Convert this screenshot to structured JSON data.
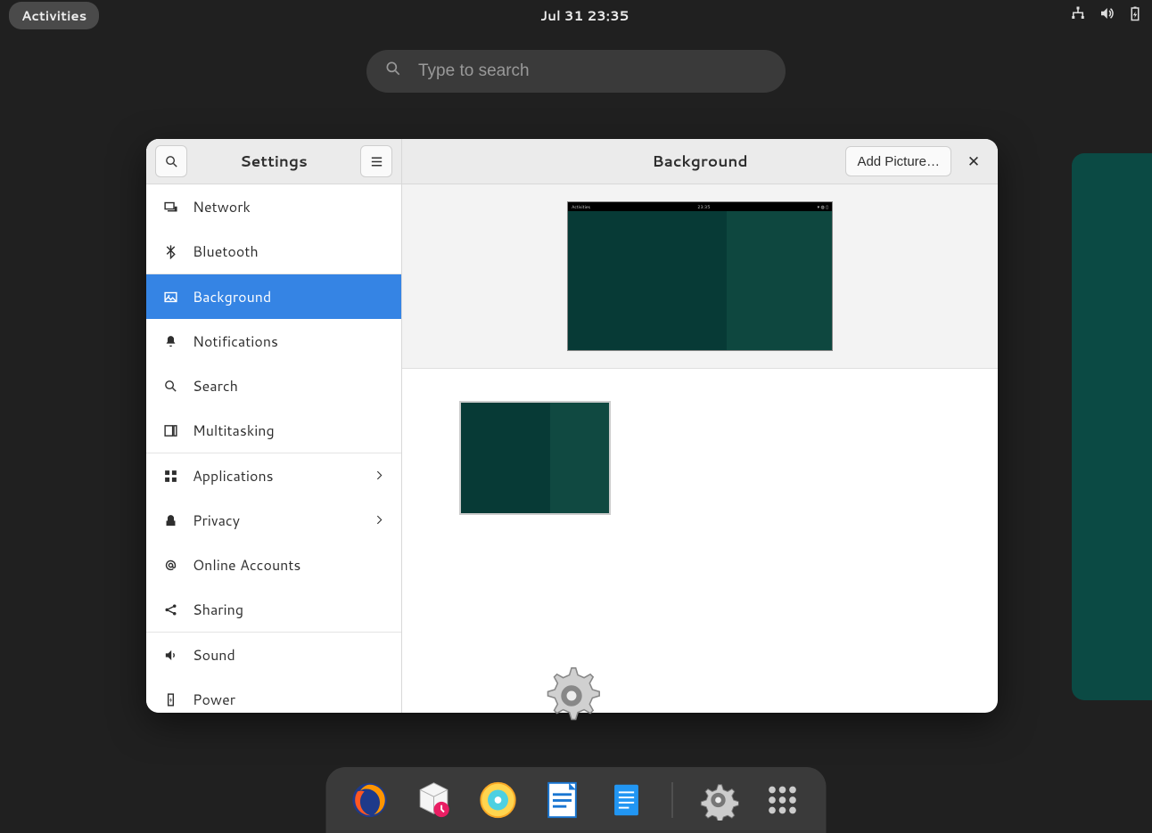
{
  "topbar": {
    "activities_label": "Activities",
    "datetime": "Jul 31  23:35"
  },
  "search": {
    "placeholder": "Type to search",
    "value": ""
  },
  "settings": {
    "title": "Settings",
    "panel_title": "Background",
    "add_picture_label": "Add Picture…",
    "items": [
      {
        "label": "Network"
      },
      {
        "label": "Bluetooth"
      },
      {
        "label": "Background"
      },
      {
        "label": "Notifications"
      },
      {
        "label": "Search"
      },
      {
        "label": "Multitasking"
      },
      {
        "label": "Applications"
      },
      {
        "label": "Privacy"
      },
      {
        "label": "Online Accounts"
      },
      {
        "label": "Sharing"
      },
      {
        "label": "Sound"
      },
      {
        "label": "Power"
      }
    ],
    "preview_bar": {
      "left": "Activities",
      "center": "23:35"
    }
  },
  "dock": {
    "apps": [
      "firefox",
      "backups",
      "disks",
      "libreoffice-writer",
      "text-editor",
      "settings",
      "show-applications"
    ]
  }
}
